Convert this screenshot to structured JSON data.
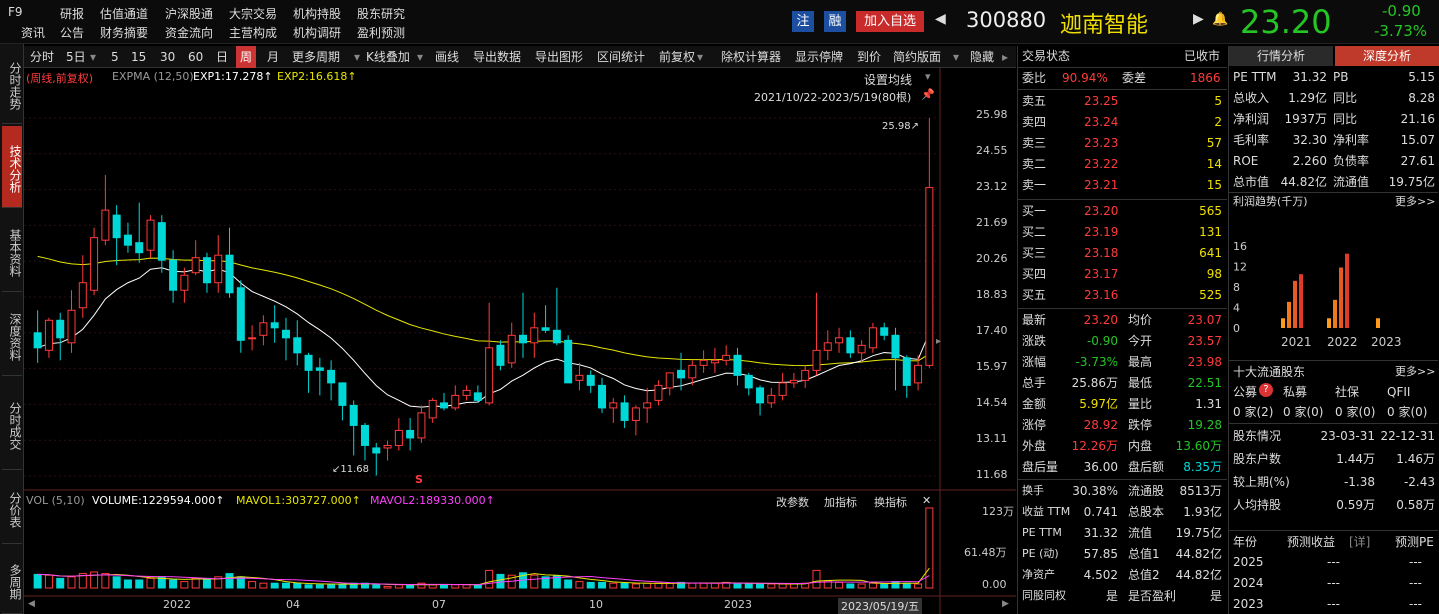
{
  "topbar": {
    "menu": [
      "F9",
      "研报",
      "估值通道",
      "沪深股通",
      "大宗交易",
      "机构持股",
      "股东研究",
      "资讯",
      "公告",
      "财务摘要",
      "资金流向",
      "主营构成",
      "机构调研",
      "盈利预测"
    ],
    "btn_zhu": "注",
    "btn_rong": "融",
    "btn_add": "加入自选",
    "code": "300880",
    "name": "迦南智能",
    "price": "23.20",
    "change": "-0.90",
    "change_pct": "-3.73%"
  },
  "vtabs": [
    "分时走势",
    "技术分析",
    "基本资料",
    "深度资料",
    "分时成交",
    "分价表",
    "多周期"
  ],
  "toolbar": {
    "items": [
      "分时",
      "5日",
      "5",
      "15",
      "30",
      "60",
      "日",
      "周",
      "月",
      "更多周期",
      "K线叠加",
      "画线",
      "导出数据",
      "导出图形",
      "区间统计",
      "前复权",
      "除权计算器",
      "显示停牌",
      "到价",
      "简约版面",
      "隐藏"
    ],
    "active": "周"
  },
  "chart": {
    "indicator_title": "(周线,前复权)",
    "indicator_name": "EXPMA (12,50)",
    "exp1": "EXP1:17.278↑",
    "exp2": "EXP2:16.618↑",
    "settings_label": "设置均线",
    "range_label": "2021/10/22-2023/5/19(80根)",
    "price_ticks": [
      "25.98",
      "24.55",
      "23.12",
      "21.69",
      "20.26",
      "18.83",
      "17.40",
      "15.97",
      "14.54",
      "13.11",
      "11.68"
    ],
    "max_label": "25.98↗",
    "min_label": "↙11.68",
    "s_marker": "S",
    "vol_title": "VOL (5,10)",
    "volume": "VOLUME:1229594.000↑",
    "mavol1": "MAVOL1:303727.000↑",
    "mavol2": "MAVOL2:189330.000↑",
    "vol_buttons": [
      "改参数",
      "加指标",
      "换指标",
      "✕"
    ],
    "vol_ticks": [
      "123万",
      "61.48万",
      "0.00"
    ],
    "x_labels": [
      "2022",
      "04",
      "07",
      "10",
      "2023"
    ],
    "date_label": "2023/05/19/五"
  },
  "panel": {
    "header": "交易状态",
    "status": "已收市",
    "weibi_label": "委比",
    "weibi": "90.94%",
    "weicha_label": "委差",
    "weicha": "1866",
    "asks": [
      {
        "l": "卖五",
        "p": "23.25",
        "v": "5"
      },
      {
        "l": "卖四",
        "p": "23.24",
        "v": "2"
      },
      {
        "l": "卖三",
        "p": "23.23",
        "v": "57"
      },
      {
        "l": "卖二",
        "p": "23.22",
        "v": "14"
      },
      {
        "l": "卖一",
        "p": "23.21",
        "v": "15"
      }
    ],
    "bids": [
      {
        "l": "买一",
        "p": "23.20",
        "v": "565"
      },
      {
        "l": "买二",
        "p": "23.19",
        "v": "131"
      },
      {
        "l": "买三",
        "p": "23.18",
        "v": "641"
      },
      {
        "l": "买四",
        "p": "23.17",
        "v": "98"
      },
      {
        "l": "买五",
        "p": "23.16",
        "v": "525"
      }
    ],
    "stats": [
      {
        "a": "最新",
        "av": "23.20",
        "ac": "up",
        "b": "均价",
        "bv": "23.07",
        "bc": "up"
      },
      {
        "a": "涨跌",
        "av": "-0.90",
        "ac": "dn",
        "b": "今开",
        "bv": "23.57",
        "bc": "up"
      },
      {
        "a": "涨幅",
        "av": "-3.73%",
        "ac": "dn",
        "b": "最高",
        "bv": "23.98",
        "bc": "up"
      },
      {
        "a": "总手",
        "av": "25.86万",
        "ac": "wh",
        "b": "最低",
        "bv": "22.51",
        "bc": "dn"
      },
      {
        "a": "金额",
        "av": "5.97亿",
        "ac": "yel",
        "b": "量比",
        "bv": "1.31",
        "bc": "wh"
      },
      {
        "a": "涨停",
        "av": "28.92",
        "ac": "up",
        "b": "跌停",
        "bv": "19.28",
        "bc": "dn"
      },
      {
        "a": "外盘",
        "av": "12.26万",
        "ac": "up",
        "b": "内盘",
        "bv": "13.60万",
        "bc": "dn"
      },
      {
        "a": "盘后量",
        "av": "36.00",
        "ac": "wh",
        "b": "盘后额",
        "bv": "8.35万",
        "bc": "cy"
      }
    ],
    "stats2": [
      {
        "a": "换手",
        "av": "30.38%",
        "b": "流通股",
        "bv": "8513万"
      },
      {
        "a": "收益 TTM",
        "av": "0.741",
        "b": "总股本",
        "bv": "1.93亿"
      },
      {
        "a": "PE TTM",
        "av": "31.32",
        "b": "流值",
        "bv": "19.75亿"
      },
      {
        "a": "PE (动)",
        "av": "57.85",
        "b": "总值1",
        "bv": "44.82亿"
      },
      {
        "a": "净资产",
        "av": "4.502",
        "b": "总值2",
        "bv": "44.82亿"
      },
      {
        "a": "同股同权",
        "av": "是",
        "b": "是否盈利",
        "bv": "是"
      }
    ]
  },
  "fin": {
    "tabs": [
      "行情分析",
      "深度分析"
    ],
    "rows": [
      {
        "a": "PE TTM",
        "av": "31.32",
        "b": "PB",
        "bv": "5.15"
      },
      {
        "a": "总收入",
        "av": "1.29亿",
        "b": "同比",
        "bv": "8.28"
      },
      {
        "a": "净利润",
        "av": "1937万",
        "b": "同比",
        "bv": "21.16"
      },
      {
        "a": "毛利率",
        "av": "32.30",
        "b": "净利率",
        "bv": "15.07"
      },
      {
        "a": "ROE",
        "av": "2.260",
        "b": "负债率",
        "bv": "27.61"
      },
      {
        "a": "总市值",
        "av": "44.82亿",
        "b": "流通值",
        "bv": "19.75亿"
      }
    ],
    "profit_title": "利润趋势(千万)",
    "more": "更多>>",
    "profit_axis": [
      "16",
      "12",
      "8",
      "4",
      "0"
    ],
    "profit_years": [
      "2021",
      "2022",
      "2023"
    ],
    "profit_bars": [
      [
        1.9,
        5.1,
        9.2,
        10.5
      ],
      [
        1.9,
        5.5,
        11.8,
        14.5
      ],
      [
        1.9
      ]
    ],
    "holders_title": "十大流通股东",
    "holder_types": [
      "公募",
      "私募",
      "社保",
      "QFII"
    ],
    "holder_counts": [
      "0 家(2)",
      "0 家(0)",
      "0 家(0)",
      "0 家(0)"
    ],
    "sh_label": "股东情况",
    "sh_d1": "23-03-31",
    "sh_d2": "22-12-31",
    "sh_rows": [
      {
        "a": "股东户数",
        "b": "1.44万",
        "c": "1.46万"
      },
      {
        "a": "较上期(%)",
        "b": "-1.38",
        "c": "-2.43"
      },
      {
        "a": "人均持股",
        "b": "0.59万",
        "c": "0.58万"
      }
    ],
    "fc_head": [
      "年份",
      "预测收益",
      "[详]",
      "预测PE"
    ],
    "fc_rows": [
      {
        "y": "2025",
        "e": "---",
        "p": "---"
      },
      {
        "y": "2024",
        "e": "---",
        "p": "---"
      },
      {
        "y": "2023",
        "e": "---",
        "p": "---"
      }
    ]
  },
  "colors": {
    "up": "#ff3b3b",
    "down": "#00d8d8",
    "exp1": "#ffffff",
    "exp2": "#e6e600",
    "mavol2": "#ff40ff"
  },
  "candles": [
    [
      17.4,
      16.8,
      18.3,
      16.2
    ],
    [
      16.7,
      17.9,
      18.0,
      16.4
    ],
    [
      17.9,
      17.2,
      18.2,
      16.3
    ],
    [
      17.0,
      18.3,
      19.1,
      16.6
    ],
    [
      18.4,
      19.4,
      20.5,
      18.0
    ],
    [
      19.1,
      21.2,
      21.6,
      18.9
    ],
    [
      21.1,
      22.3,
      23.7,
      20.9
    ],
    [
      22.1,
      21.2,
      22.5,
      20.1
    ],
    [
      21.3,
      20.9,
      21.8,
      20.6
    ],
    [
      21.0,
      20.6,
      22.6,
      20.2
    ],
    [
      20.7,
      21.9,
      22.1,
      20.4
    ],
    [
      21.8,
      20.3,
      22.1,
      19.8
    ],
    [
      20.3,
      19.1,
      20.7,
      18.6
    ],
    [
      19.1,
      19.7,
      20.0,
      18.6
    ],
    [
      19.8,
      20.4,
      21.1,
      19.7
    ],
    [
      20.4,
      19.4,
      20.6,
      19.0
    ],
    [
      19.4,
      20.5,
      21.3,
      19.0
    ],
    [
      20.5,
      19.0,
      21.6,
      18.8
    ],
    [
      19.2,
      17.1,
      19.5,
      16.6
    ],
    [
      17.2,
      17.2,
      17.7,
      16.7
    ],
    [
      17.3,
      17.8,
      18.1,
      16.9
    ],
    [
      17.8,
      17.6,
      18.5,
      17.0
    ],
    [
      17.5,
      17.2,
      18.0,
      16.3
    ],
    [
      17.2,
      16.6,
      17.9,
      16.1
    ],
    [
      16.5,
      15.9,
      16.6,
      15.0
    ],
    [
      16.0,
      15.9,
      16.4,
      14.9
    ],
    [
      15.9,
      15.4,
      16.3,
      14.7
    ],
    [
      15.4,
      14.5,
      15.4,
      13.9
    ],
    [
      14.5,
      13.7,
      14.7,
      12.5
    ],
    [
      13.7,
      12.9,
      13.8,
      12.3
    ],
    [
      12.8,
      12.6,
      13.0,
      11.7
    ],
    [
      12.8,
      12.9,
      13.1,
      12.3
    ],
    [
      12.9,
      13.5,
      14.0,
      12.7
    ],
    [
      13.5,
      13.2,
      14.0,
      12.7
    ],
    [
      13.2,
      14.2,
      14.5,
      13.0
    ],
    [
      14.0,
      14.7,
      14.8,
      13.8
    ],
    [
      14.6,
      14.4,
      15.0,
      14.3
    ],
    [
      14.4,
      14.9,
      15.3,
      14.3
    ],
    [
      14.9,
      15.1,
      15.3,
      14.7
    ],
    [
      15.0,
      14.7,
      15.3,
      14.6
    ],
    [
      14.6,
      16.8,
      18.6,
      14.5
    ],
    [
      16.9,
      16.1,
      17.1,
      15.9
    ],
    [
      16.2,
      17.3,
      17.8,
      16.0
    ],
    [
      17.3,
      17.0,
      19.0,
      16.4
    ],
    [
      17.0,
      17.6,
      18.2,
      16.4
    ],
    [
      17.6,
      17.5,
      18.5,
      17.4
    ],
    [
      17.5,
      17.0,
      19.2,
      16.9
    ],
    [
      17.1,
      15.4,
      17.3,
      15.4
    ],
    [
      15.5,
      15.7,
      16.2,
      15.1
    ],
    [
      15.7,
      15.3,
      15.9,
      15.0
    ],
    [
      15.3,
      14.4,
      15.6,
      14.2
    ],
    [
      14.4,
      14.6,
      14.8,
      13.8
    ],
    [
      14.6,
      13.9,
      14.9,
      13.6
    ],
    [
      13.9,
      14.4,
      14.5,
      13.3
    ],
    [
      14.4,
      14.6,
      15.2,
      13.8
    ],
    [
      14.7,
      15.3,
      15.5,
      14.5
    ],
    [
      15.2,
      15.8,
      15.8,
      14.9
    ],
    [
      15.9,
      15.6,
      16.6,
      15.1
    ],
    [
      15.6,
      16.1,
      16.3,
      15.3
    ],
    [
      16.1,
      16.3,
      16.7,
      15.8
    ],
    [
      16.2,
      16.3,
      16.8,
      15.8
    ],
    [
      16.3,
      16.5,
      16.9,
      16.1
    ],
    [
      16.5,
      15.7,
      16.8,
      15.3
    ],
    [
      15.7,
      15.2,
      15.8,
      14.9
    ],
    [
      15.2,
      14.6,
      15.3,
      14.1
    ],
    [
      14.6,
      14.9,
      15.2,
      14.4
    ],
    [
      14.9,
      15.4,
      15.8,
      14.7
    ],
    [
      15.4,
      15.5,
      15.8,
      15.2
    ],
    [
      15.5,
      15.9,
      16.1,
      15.2
    ],
    [
      15.9,
      16.7,
      19.0,
      15.7
    ],
    [
      16.7,
      17.0,
      17.5,
      16.3
    ],
    [
      17.0,
      17.2,
      17.6,
      16.6
    ],
    [
      17.2,
      16.6,
      17.5,
      16.4
    ],
    [
      16.6,
      16.9,
      17.1,
      16.2
    ],
    [
      16.8,
      17.6,
      17.8,
      16.6
    ],
    [
      17.6,
      17.3,
      17.8,
      17.1
    ],
    [
      17.3,
      16.4,
      17.6,
      15.1
    ],
    [
      16.4,
      15.3,
      16.5,
      14.8
    ],
    [
      15.4,
      16.1,
      16.5,
      15.1
    ],
    [
      16.1,
      23.2,
      25.98,
      16.0
    ]
  ],
  "volumes": [
    0.17,
    0.16,
    0.12,
    0.14,
    0.18,
    0.2,
    0.18,
    0.14,
    0.1,
    0.1,
    0.12,
    0.14,
    0.1,
    0.08,
    0.12,
    0.12,
    0.14,
    0.18,
    0.14,
    0.08,
    0.06,
    0.06,
    0.06,
    0.06,
    0.04,
    0.04,
    0.05,
    0.05,
    0.06,
    0.06,
    0.04,
    0.02,
    0.04,
    0.04,
    0.06,
    0.04,
    0.04,
    0.04,
    0.04,
    0.04,
    0.22,
    0.17,
    0.16,
    0.19,
    0.16,
    0.14,
    0.15,
    0.1,
    0.08,
    0.07,
    0.07,
    0.06,
    0.06,
    0.05,
    0.06,
    0.06,
    0.06,
    0.07,
    0.06,
    0.06,
    0.06,
    0.07,
    0.06,
    0.05,
    0.05,
    0.05,
    0.05,
    0.05,
    0.06,
    0.22,
    0.09,
    0.07,
    0.05,
    0.05,
    0.06,
    0.05,
    0.08,
    0.06,
    0.05,
    1.0
  ]
}
